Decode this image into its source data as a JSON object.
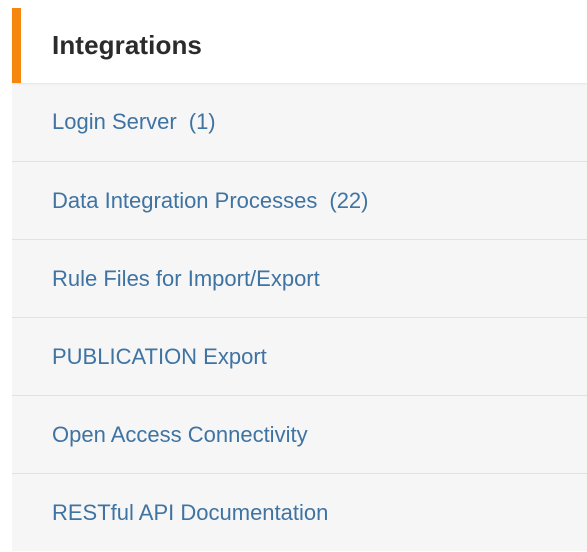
{
  "panel": {
    "title": "Integrations",
    "items": [
      {
        "label": "Login Server",
        "count": "(1)"
      },
      {
        "label": "Data Integration Processes",
        "count": "(22)"
      },
      {
        "label": "Rule Files for Import/Export",
        "count": ""
      },
      {
        "label": "PUBLICATION Export",
        "count": ""
      },
      {
        "label": "Open Access Connectivity",
        "count": ""
      },
      {
        "label": "RESTful API Documentation",
        "count": ""
      }
    ]
  },
  "colors": {
    "accent": "#f5870f",
    "link": "#3f73a2",
    "title": "#2b2b2b",
    "item_bg": "#f6f6f6",
    "divider": "#e1e1e1"
  }
}
